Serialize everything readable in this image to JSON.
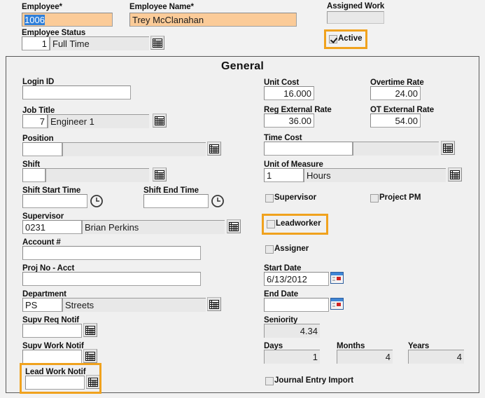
{
  "header": {
    "employee": {
      "label": "Employee*",
      "value": "1006",
      "selected": true
    },
    "employee_name": {
      "label": "Employee Name*",
      "value": "Trey McClanahan"
    },
    "employee_status": {
      "label": "Employee Status",
      "code": "1",
      "desc": "Full Time"
    },
    "assigned_work": {
      "label": "Assigned Work",
      "value": ""
    },
    "active": {
      "label": "Active",
      "checked": true,
      "highlighted": true
    }
  },
  "panel": {
    "title": "General"
  },
  "left": {
    "login_id": {
      "label": "Login ID",
      "value": ""
    },
    "job_title": {
      "label": "Job Title",
      "code": "7",
      "desc": "Engineer 1"
    },
    "position": {
      "label": "Position",
      "code": "",
      "desc": ""
    },
    "shift": {
      "label": "Shift",
      "code": "",
      "desc": ""
    },
    "shift_start": {
      "label": "Shift Start Time",
      "value": ""
    },
    "shift_end": {
      "label": "Shift End Time",
      "value": ""
    },
    "supervisor": {
      "label": "Supervisor",
      "code": "0231",
      "desc": "Brian Perkins"
    },
    "account_no": {
      "label": "Account #",
      "value": ""
    },
    "proj_no_acct": {
      "label": "Proj No - Acct",
      "value": ""
    },
    "department": {
      "label": "Department",
      "code": "PS",
      "desc": "Streets"
    },
    "supv_req_notif": {
      "label": "Supv Req Notif",
      "value": ""
    },
    "supv_work_notif": {
      "label": "Supv Work Notif",
      "value": ""
    },
    "lead_work_notif": {
      "label": "Lead Work Notif",
      "value": "",
      "highlighted": true
    }
  },
  "right": {
    "unit_cost": {
      "label": "Unit Cost",
      "value": "16.000"
    },
    "overtime_rate": {
      "label": "Overtime Rate",
      "value": "24.00"
    },
    "reg_external_rate": {
      "label": "Reg External Rate",
      "value": "36.00"
    },
    "ot_external_rate": {
      "label": "OT External Rate",
      "value": "54.00"
    },
    "time_cost": {
      "label": "Time Cost",
      "code": "",
      "desc": ""
    },
    "unit_of_measure": {
      "label": "Unit of Measure",
      "code": "1",
      "desc": "Hours"
    },
    "supervisor_cb": {
      "label": "Supervisor",
      "checked": false
    },
    "project_pm_cb": {
      "label": "Project PM",
      "checked": false
    },
    "leadworker_cb": {
      "label": "Leadworker",
      "checked": false,
      "highlighted": true
    },
    "assigner_cb": {
      "label": "Assigner",
      "checked": false
    },
    "start_date": {
      "label": "Start Date",
      "value": "6/13/2012"
    },
    "end_date": {
      "label": "End Date",
      "value": ""
    },
    "seniority": {
      "label": "Seniority",
      "value": "4.34"
    },
    "days": {
      "label": "Days",
      "value": "1"
    },
    "months": {
      "label": "Months",
      "value": "4"
    },
    "years": {
      "label": "Years",
      "value": "4"
    },
    "journal_entry_import": {
      "label": "Journal Entry Import",
      "checked": false
    }
  },
  "icons": {
    "lookup": "lookup-grid-icon",
    "clock": "clock-icon",
    "calendar": "calendar-icon"
  },
  "colors": {
    "highlight": "#f0a21e",
    "required_field": "#fbcb98",
    "selection": "#2f7fd9"
  }
}
